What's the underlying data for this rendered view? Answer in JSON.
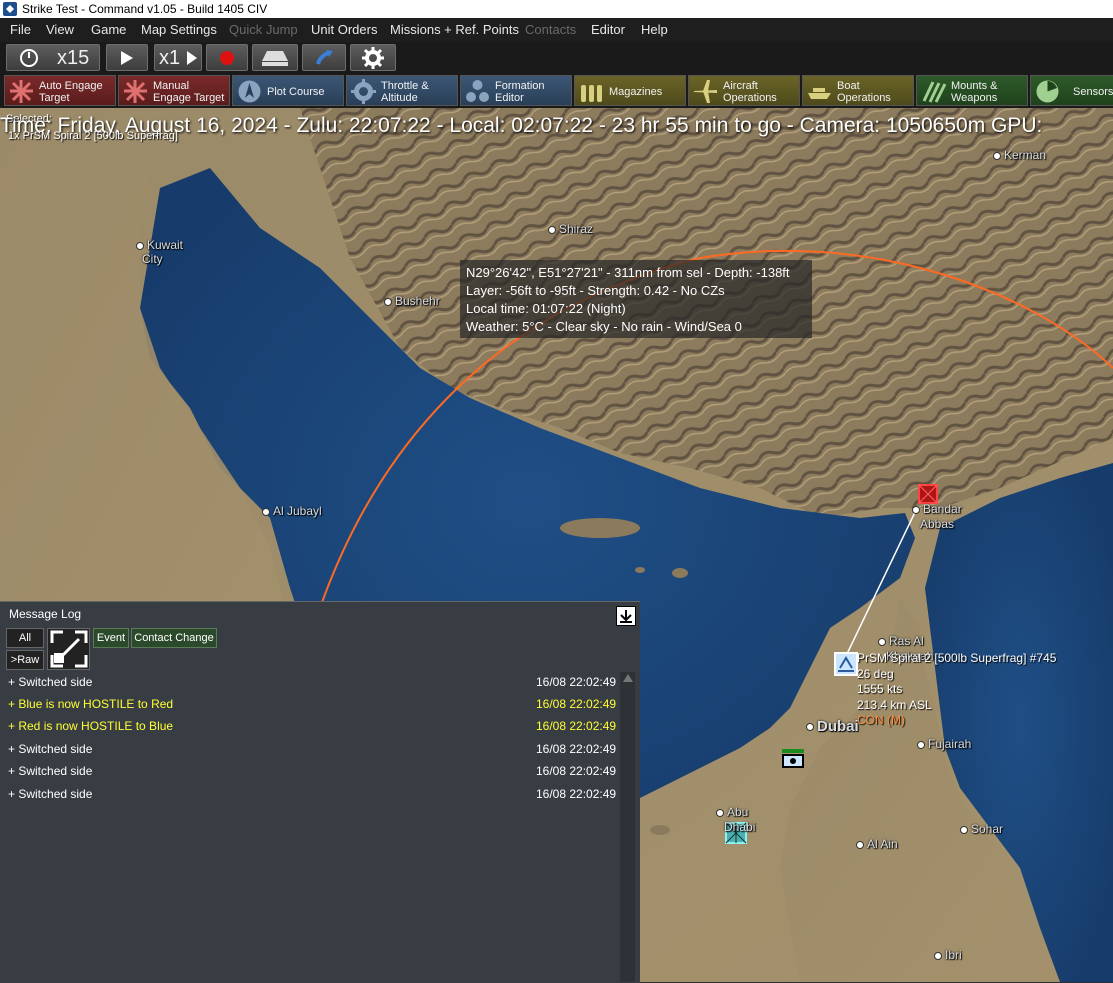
{
  "window": {
    "title": "Strike Test - Command v1.05 - Build 1405 CIV"
  },
  "menu": [
    {
      "label": "File",
      "enabled": true
    },
    {
      "label": "View",
      "enabled": true
    },
    {
      "label": "Game",
      "enabled": true
    },
    {
      "label": "Map Settings",
      "enabled": true
    },
    {
      "label": "Quick Jump",
      "enabled": false
    },
    {
      "label": "Unit Orders",
      "enabled": true
    },
    {
      "label": "Missions + Ref. Points",
      "enabled": true
    },
    {
      "label": "Contacts",
      "enabled": false
    },
    {
      "label": "Editor",
      "enabled": true
    },
    {
      "label": "Help",
      "enabled": true
    }
  ],
  "timecontrols": {
    "compression": "x15",
    "step": "x1"
  },
  "actions": [
    {
      "line1": "Auto Engage",
      "line2": "Target",
      "icon": "auto-engage-icon",
      "color": "#7a2a2a"
    },
    {
      "line1": "Manual",
      "line2": "Engage Target",
      "icon": "manual-engage-icon",
      "color": "#7a2a2a"
    },
    {
      "line1": "Plot Course",
      "line2": "",
      "icon": "plot-course-icon",
      "color": "#3b5775"
    },
    {
      "line1": "Throttle &",
      "line2": "Altitude",
      "icon": "throttle-icon",
      "color": "#3b5775"
    },
    {
      "line1": "Formation",
      "line2": "Editor",
      "icon": "formation-icon",
      "color": "#3b5775"
    },
    {
      "line1": "Magazines",
      "line2": "",
      "icon": "magazines-icon",
      "color": "#6a6428"
    },
    {
      "line1": "Aircraft",
      "line2": "Operations",
      "icon": "aircraft-icon",
      "color": "#6a6428"
    },
    {
      "line1": "Boat",
      "line2": "Operations",
      "icon": "boat-icon",
      "color": "#6a6428"
    },
    {
      "line1": "Mounts &",
      "line2": "Weapons",
      "icon": "mounts-icon",
      "color": "#2e5a2a"
    },
    {
      "line1": "Sensors",
      "line2": "",
      "icon": "sensors-icon",
      "color": "#2e5a2a"
    }
  ],
  "hud": {
    "status": "Time: Friday, August 16, 2024 - Zulu: 22:07:22 - Local: 02:07:22 - 23 hr 55 min to go -  Camera: 1050650m  GPU:",
    "selected_label": "Selected:",
    "selected_unit": "1x PrSM Spiral 2 [500lb Superfrag]"
  },
  "tooltip": {
    "line1": "N29°26'42\", E51°27'21\" - 311nm from sel - Depth: -138ft",
    "line2": "Layer: -56ft to -95ft - Strength: 0.42 - No CZs",
    "line3": "Local time: 01:07:22 (Night)",
    "line4": "Weather: 5°C - Clear sky - No rain - Wind/Sea 0"
  },
  "cities": {
    "kerman": "Kerman",
    "shiraz": "Shiraz",
    "kuwait": "Kuwait",
    "kuwait2": "City",
    "bushehr": "Bushehr",
    "alubayl": "Al Jubayl",
    "bandar": "Bandar",
    "abbas": "Abbas",
    "rasal": "Ras Al",
    "khaimah": "Khaimah",
    "dubai": "Dubai",
    "fujairah": "Fujairah",
    "abu": "Abu",
    "dhabi": "Dhabi",
    "alain": "Al Ain",
    "sohar": "Sohar",
    "ibri": "Ibri"
  },
  "unit": {
    "name": "PrSM Spiral 2 [500lb Superfrag] #745",
    "heading": "26 deg",
    "speed": "1555 kts",
    "altitude": "213.4 km ASL",
    "mission": "CON (M)"
  },
  "messagelog": {
    "title": "Message Log",
    "filter_all": "All",
    "filter_raw": ">Raw",
    "filter_event": "Event",
    "filter_contact": "Contact Change",
    "rows": [
      {
        "text": "Switched side",
        "time": "16/08 22:02:49",
        "highlight": false
      },
      {
        "text": "Blue is now HOSTILE to Red",
        "time": "16/08 22:02:49",
        "highlight": true
      },
      {
        "text": "Red is now HOSTILE to Blue",
        "time": "16/08 22:02:49",
        "highlight": true
      },
      {
        "text": "Switched side",
        "time": "16/08 22:02:49",
        "highlight": false
      },
      {
        "text": "Switched side",
        "time": "16/08 22:02:49",
        "highlight": false
      },
      {
        "text": "Switched side",
        "time": "16/08 22:02:49",
        "highlight": false
      }
    ]
  }
}
